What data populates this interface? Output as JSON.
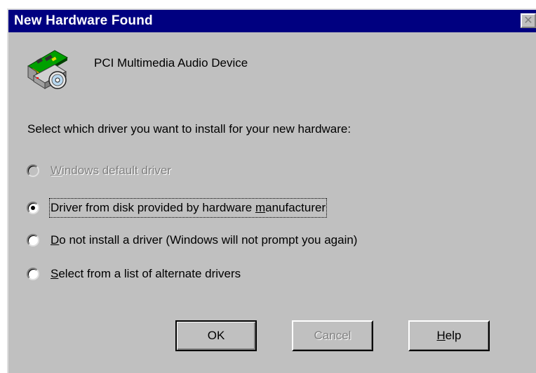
{
  "window": {
    "title": "New Hardware Found",
    "close_glyph": "✕"
  },
  "device": {
    "name": "PCI Multimedia Audio Device",
    "icon": "hardware-card-icon"
  },
  "prompt": "Select which driver you want to install for your new hardware:",
  "options": [
    {
      "pre": "",
      "key": "W",
      "post": "indows default driver",
      "enabled": false,
      "selected": false
    },
    {
      "pre": "Driver from disk provided by hardware ",
      "key": "m",
      "post": "anufacturer",
      "enabled": true,
      "selected": true
    },
    {
      "pre": "",
      "key": "D",
      "post": "o not install a driver (Windows will not prompt you again)",
      "enabled": true,
      "selected": false
    },
    {
      "pre": "",
      "key": "S",
      "post": "elect from a list of alternate drivers",
      "enabled": true,
      "selected": false
    }
  ],
  "buttons": {
    "ok": {
      "label": "OK"
    },
    "cancel": {
      "label": "Cancel"
    },
    "help": {
      "key": "H",
      "rest": "elp"
    }
  },
  "colors": {
    "titlebar": "#000080",
    "face": "#c0c0c0",
    "disabled_text": "#808080"
  }
}
